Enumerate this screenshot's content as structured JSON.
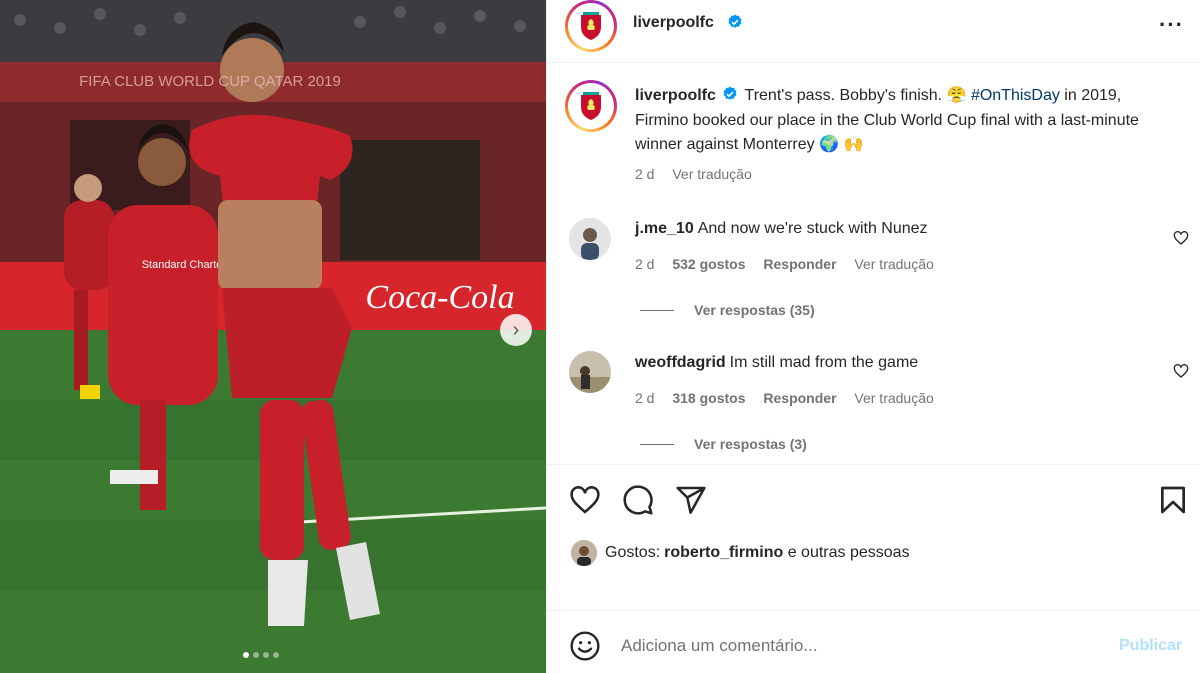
{
  "media": {
    "banner_text": "FIFA CLUB WORLD CUP QATAR 2019",
    "ad_text": "Coca-Cola",
    "shirt_sponsor": "Standard Chartered",
    "next_icon": "chevron-right-icon",
    "slide_count": 4,
    "active_slide": 1
  },
  "header": {
    "username": "liverpoolfc",
    "verified_icon": "verified-badge-icon",
    "more_icon": "more-options-icon",
    "more_glyph": "···"
  },
  "caption": {
    "username": "liverpoolfc",
    "text_before": "Trent's pass. Bobby's finish. 😤 ",
    "hashtag": "#OnThisDay",
    "text_after": " in 2019, Firmino booked our place in the Club World Cup final with a last-minute winner against Monterrey 🌍 🙌",
    "time": "2 d",
    "translate": "Ver tradução"
  },
  "comments": [
    {
      "username": "j.me_10",
      "text": "And now we're stuck with Nunez",
      "time": "2 d",
      "likes": "532 gostos",
      "reply": "Responder",
      "translate": "Ver tradução",
      "view_replies": "Ver respostas (35)"
    },
    {
      "username": "weoffdagrid",
      "text": "Im still mad from the game",
      "time": "2 d",
      "likes": "318 gostos",
      "reply": "Responder",
      "translate": "Ver tradução",
      "view_replies": "Ver respostas (3)"
    }
  ],
  "actions": {
    "like_icon": "heart-icon",
    "comment_icon": "comment-icon",
    "share_icon": "share-icon",
    "save_icon": "bookmark-icon"
  },
  "likes": {
    "prefix": "Gostos: ",
    "user": "roberto_firmino",
    "suffix": " e outras pessoas"
  },
  "add_comment": {
    "emoji_icon": "emoji-icon",
    "placeholder": "Adiciona um comentário...",
    "publish": "Publicar"
  },
  "colors": {
    "verified": "#0095f6",
    "hashtag": "#00376b",
    "publish_disabled": "#b2dffc",
    "secondary_text": "#737373"
  }
}
